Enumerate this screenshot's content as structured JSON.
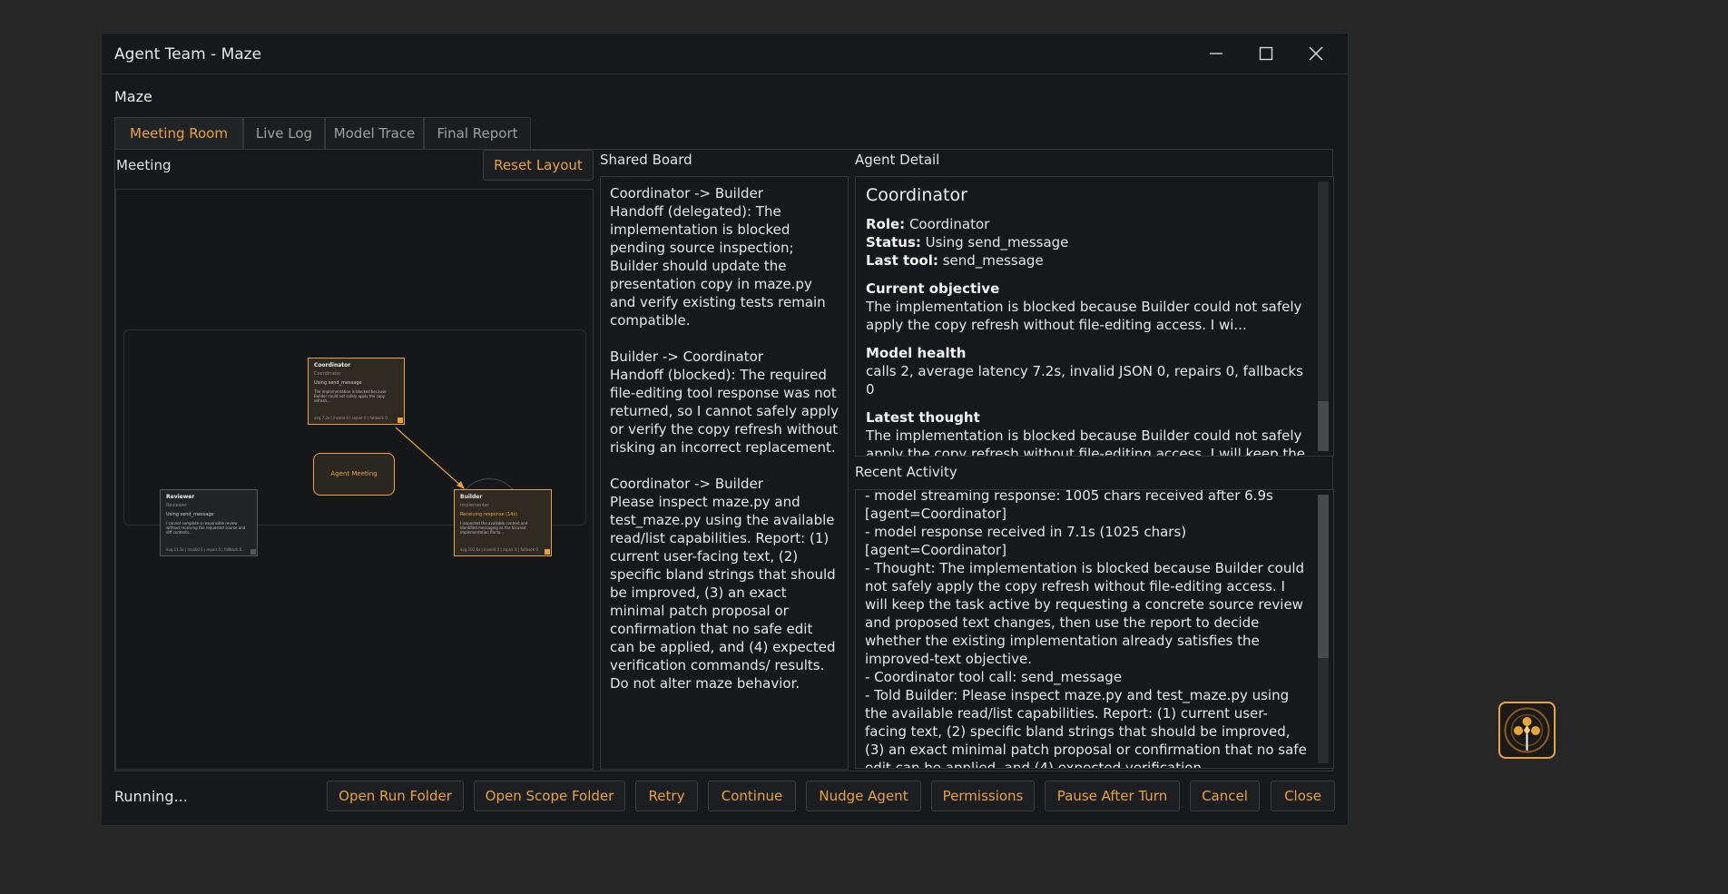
{
  "window": {
    "title": "Agent Team - Maze",
    "controls": {
      "minimize": "minimize-icon",
      "maximize": "maximize-icon",
      "close": "close-icon"
    }
  },
  "project_name": "Maze",
  "tabs": [
    {
      "label": "Meeting Room",
      "active": true
    },
    {
      "label": "Live Log",
      "active": false
    },
    {
      "label": "Model Trace",
      "active": false
    },
    {
      "label": "Final Report",
      "active": false
    }
  ],
  "meeting": {
    "label": "Meeting",
    "reset_button": "Reset Layout",
    "center_node": "Agent Meeting",
    "agents": [
      {
        "name": "Coordinator",
        "role": "Coordinator",
        "status": "Using send_message",
        "desc": "The implementation is blocked because Builder could not safely apply the copy refresh...",
        "metrics": "avg 7.2s | invalid 0 | repair 0 | fallback 0"
      },
      {
        "name": "Reviewer",
        "role": "Reviewer",
        "status": "Using send_message",
        "desc": "I cannot complete a responsible review without receiving the requested source and diff contents...",
        "metrics": "avg 11.5s | invalid 0 | repair 0 | fallback 0"
      },
      {
        "name": "Builder",
        "role": "Implementer",
        "status": "Receiving response (14s)",
        "desc": "I inspected the available context and identified messaging as the focused implementation file to...",
        "metrics": "avg 102.6s | invalid 0 | repair 0 | fallback 0"
      }
    ]
  },
  "shared_board": {
    "label": "Shared Board",
    "entries": [
      {
        "header": "Coordinator -> Builder",
        "body": "Handoff (delegated): The implementation is blocked pending source inspection; Builder should update the presentation copy in maze.py and verify existing tests remain compatible."
      },
      {
        "header": "Builder -> Coordinator",
        "body": "Handoff (blocked): The required file-editing tool response was not returned, so I cannot safely apply or verify the copy refresh without risking an incorrect replacement."
      },
      {
        "header": "Coordinator -> Builder",
        "body": "Please inspect maze.py and test_maze.py using the available read/list capabilities. Report: (1) current user-facing text, (2) specific bland strings that should be improved, (3) an exact minimal patch proposal or confirmation that no safe edit can be applied, and (4) expected verification commands/ results. Do not alter maze behavior."
      }
    ]
  },
  "agent_detail": {
    "label": "Agent Detail",
    "name": "Coordinator",
    "role_key": "Role:",
    "role": "Coordinator",
    "status_key": "Status:",
    "status": "Using send_message",
    "last_tool_key": "Last tool:",
    "last_tool": "send_message",
    "objective_heading": "Current objective",
    "objective": "The implementation is blocked because Builder could not safely apply the copy refresh without file-editing access. I wi...",
    "health_heading": "Model health",
    "health": "calls 2, average latency 7.2s, invalid JSON 0, repairs 0, fallbacks 0",
    "thought_heading": "Latest thought",
    "thought": "The implementation is blocked because Builder could not safely apply the copy refresh without file-editing access. I will keep the task active"
  },
  "recent_activity": {
    "label": "Recent Activity",
    "lines": [
      "- model streaming response: 1005 chars received after 6.9s",
      "[agent=Coordinator]",
      "- model response received in 7.1s (1025 chars) [agent=Coordinator]",
      "- Thought: The implementation is blocked because Builder could not safely apply the copy refresh without file-editing access. I will keep the task active by requesting a concrete source review and proposed text changes, then use the report to decide whether the existing implementation already satisfies the improved-text objective.",
      "- Coordinator tool call: send_message",
      "- Told Builder: Please inspect maze.py and test_maze.py using the available read/list capabilities. Report: (1) current user-facing text, (2) specific bland strings that should be improved, (3) an exact minimal patch proposal or confirmation that no safe edit can be applied, and (4) expected verification commands/results. Do not alter maze behavior."
    ]
  },
  "footer": {
    "status": "Running...",
    "buttons": [
      "Open Run Folder",
      "Open Scope Folder",
      "Retry",
      "Continue",
      "Nudge Agent",
      "Permissions",
      "Pause After Turn",
      "Cancel",
      "Close"
    ]
  },
  "taskbar_icon": "agent-team-app-icon",
  "colors": {
    "accent": "#e8a33d",
    "background": "#17181b",
    "desktop": "#262626"
  }
}
